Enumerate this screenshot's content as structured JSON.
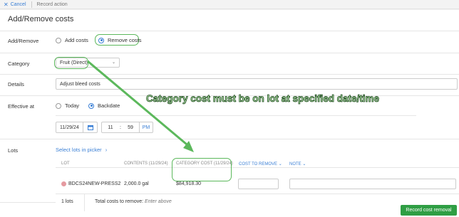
{
  "topbar": {
    "cancel_label": "Cancel",
    "breadcrumb": "Record action"
  },
  "page_title": "Add/Remove costs",
  "add_remove": {
    "label": "Add/Remove",
    "options": [
      "Add costs",
      "Remove costs"
    ],
    "selected": "Remove costs"
  },
  "category": {
    "label": "Category",
    "value": "Fruit (Direct)"
  },
  "details": {
    "label": "Details",
    "value": "Adjust bleed costs"
  },
  "effective_at": {
    "label": "Effective at",
    "options": [
      "Today",
      "Backdate"
    ],
    "selected": "Backdate",
    "date": "11/29/24",
    "hour": "11",
    "colon": ":",
    "minute": "59",
    "ampm": "PM"
  },
  "lots": {
    "label": "Lots",
    "select_link": "Select lots in picker",
    "columns": [
      "LOT",
      "CONTENTS (11/29/24)",
      "CATEGORY COST (11/29/24)",
      "COST TO REMOVE",
      "NOTE"
    ],
    "rows": [
      {
        "lot": "BDCS24NEW-PRESS2",
        "contents": "2,000.0 gal",
        "category_cost": "$84,918.30",
        "cost_to_remove": "",
        "note": ""
      }
    ],
    "footer_count": "1 lots",
    "footer_total_label": "Total costs to remove:",
    "footer_total_value": "Enter above"
  },
  "annotation": "Category cost must be on lot at specified date/time",
  "submit_label": "Record cost removal",
  "colors": {
    "accent": "#3a7fd5",
    "primary": "#2f9e44",
    "highlight": "#5cb85c"
  }
}
